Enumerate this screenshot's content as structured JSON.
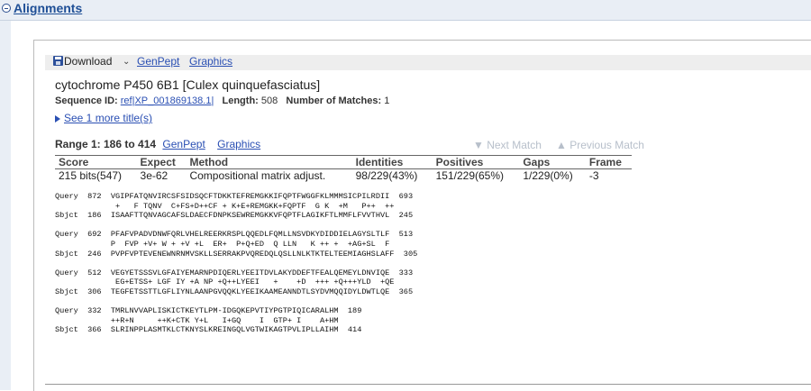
{
  "section": {
    "title": "Alignments",
    "collapse_symbol": "−"
  },
  "toolbar": {
    "download_label": "Download",
    "download_caret": "⌄",
    "genpept_label": "GenPept",
    "graphics_label": "Graphics",
    "icon": "disk-icon"
  },
  "hit": {
    "title": "cytochrome P450 6B1 [Culex quinquefasciatus]",
    "sequence_id_label": "Sequence ID:",
    "sequence_id": "ref|XP_001869138.1|",
    "length_label": "Length:",
    "length": "508",
    "matches_label": "Number of Matches:",
    "matches": "1",
    "see_more": "See 1 more title(s)"
  },
  "range": {
    "label": "Range 1: 186 to 414",
    "genpept_label": "GenPept",
    "graphics_label": "Graphics",
    "next_match": "▼ Next Match",
    "previous_match": "▲ Previous Match"
  },
  "stats": {
    "headers": [
      "Score",
      "Expect",
      "Method",
      "Identities",
      "Positives",
      "Gaps",
      "Frame"
    ],
    "row": [
      "215 bits(547)",
      "3e-62",
      "Compositional matrix adjust.",
      "98/229(43%)",
      "151/229(65%)",
      "1/229(0%)",
      "-3"
    ]
  },
  "alignment_text": "Query  872  VGIPFATQNVIRCSFSIDSQCFTDKKTEFREMGKKIFQPTFWGGFKLMMMSICPILRDII  693\n             +   F TQNV  C+FS+D++CF + K+E+REMGKK+FQPTF  G K  +M   P++  ++\nSbjct  186  ISAAFTTQNVAGCAFSLDAECFDNPKSEWREMGKKVFQPTFLAGIKFTLMMFLFVVTHVL  245\n\nQuery  692  PFAFVPADVDNWFQRLVHELREERKRSPLQQEDLFQMLLNSVDKYDIDDIELAGYSLTLF  513\n            P  FVP +V+ W + +V +L  ER+  P+Q+ED  Q LLN   K ++ +  +AG+SL  F\nSbjct  246  PVPFVPTEVENEWNRNMVSKLLSERRAKPVQREDQLQSLLNLKTKTELTEEMIAGHSLAFF  305\n\nQuery  512  VEGYETSSSVLGFAIYEMARNPDIQERLYEEITDVLAKYDDEFTFEALQEMEYLDNVIQE  333\n             EG+ETSS+ LGF IY +A NP +Q++LYEEI   +    +D  +++ +Q+++YLD  +QE\nSbjct  306  TEGFETSSTTLGFLIYNLAANPGVQQKLYEEIKAAMEANNDTLSYDVMQQIDYLDWTLQE  365\n\nQuery  332  TMRLNVVAPLISKICTKEYTLPM-IDGQKEPVTIYPGTPIQICARALHM  189\n            ++R+N     ++K+CTK Y+L   I+GQ    I  GTP+ I    A+HM\nSbjct  366  SLRINPPLASMTKLCTKNYSLKREINGQLVGTWIKAGTPVLIPLLAIHM  414"
}
